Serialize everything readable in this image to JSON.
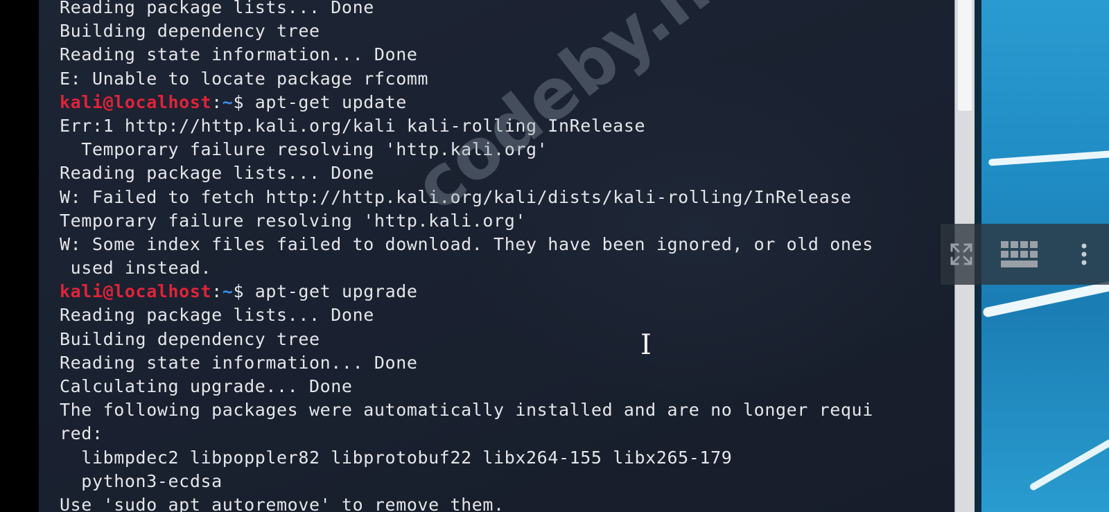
{
  "terminal": {
    "lines": [
      {
        "type": "text",
        "text": "Reading package lists... Done"
      },
      {
        "type": "text",
        "text": "Building dependency tree"
      },
      {
        "type": "text",
        "text": "Reading state information... Done"
      },
      {
        "type": "text",
        "text": "E: Unable to locate package rfcomm"
      },
      {
        "type": "prompt",
        "user": "kali@localhost",
        "sep": ":",
        "path": "~",
        "symbol": "$ ",
        "command": "apt-get update"
      },
      {
        "type": "text",
        "text": "Err:1 http://http.kali.org/kali kali-rolling InRelease"
      },
      {
        "type": "text",
        "text": "  Temporary failure resolving 'http.kali.org'"
      },
      {
        "type": "text",
        "text": "Reading package lists... Done"
      },
      {
        "type": "text",
        "text": "W: Failed to fetch http://http.kali.org/kali/dists/kali-rolling/InRelease"
      },
      {
        "type": "text",
        "text": "Temporary failure resolving 'http.kali.org'"
      },
      {
        "type": "text",
        "text": "W: Some index files failed to download. They have been ignored, or old ones"
      },
      {
        "type": "text",
        "text": " used instead."
      },
      {
        "type": "prompt",
        "user": "kali@localhost",
        "sep": ":",
        "path": "~",
        "symbol": "$ ",
        "command": "apt-get upgrade"
      },
      {
        "type": "text",
        "text": "Reading package lists... Done"
      },
      {
        "type": "text",
        "text": "Building dependency tree"
      },
      {
        "type": "text",
        "text": "Reading state information... Done"
      },
      {
        "type": "text",
        "text": "Calculating upgrade... Done"
      },
      {
        "type": "text",
        "text": "The following packages were automatically installed and are no longer requi"
      },
      {
        "type": "text",
        "text": "red:"
      },
      {
        "type": "text",
        "text": "  libmpdec2 libpoppler82 libprotobuf22 libx264-155 libx265-179"
      },
      {
        "type": "text",
        "text": "  python3-ecdsa"
      },
      {
        "type": "text",
        "text": "Use 'sudo apt autoremove' to remove them."
      }
    ]
  },
  "watermark": {
    "text": "codeby.net"
  },
  "overlay": {
    "expand_icon": "expand-icon",
    "grid_icon": "keyboard-grid-icon",
    "more_icon": "more-vertical-icon"
  },
  "cursor_glyph": "I",
  "colors": {
    "terminal_bg": "#1b2231",
    "terminal_text": "#e4e6ea",
    "prompt_user": "#e0233a",
    "prompt_path": "#3c8be6"
  }
}
